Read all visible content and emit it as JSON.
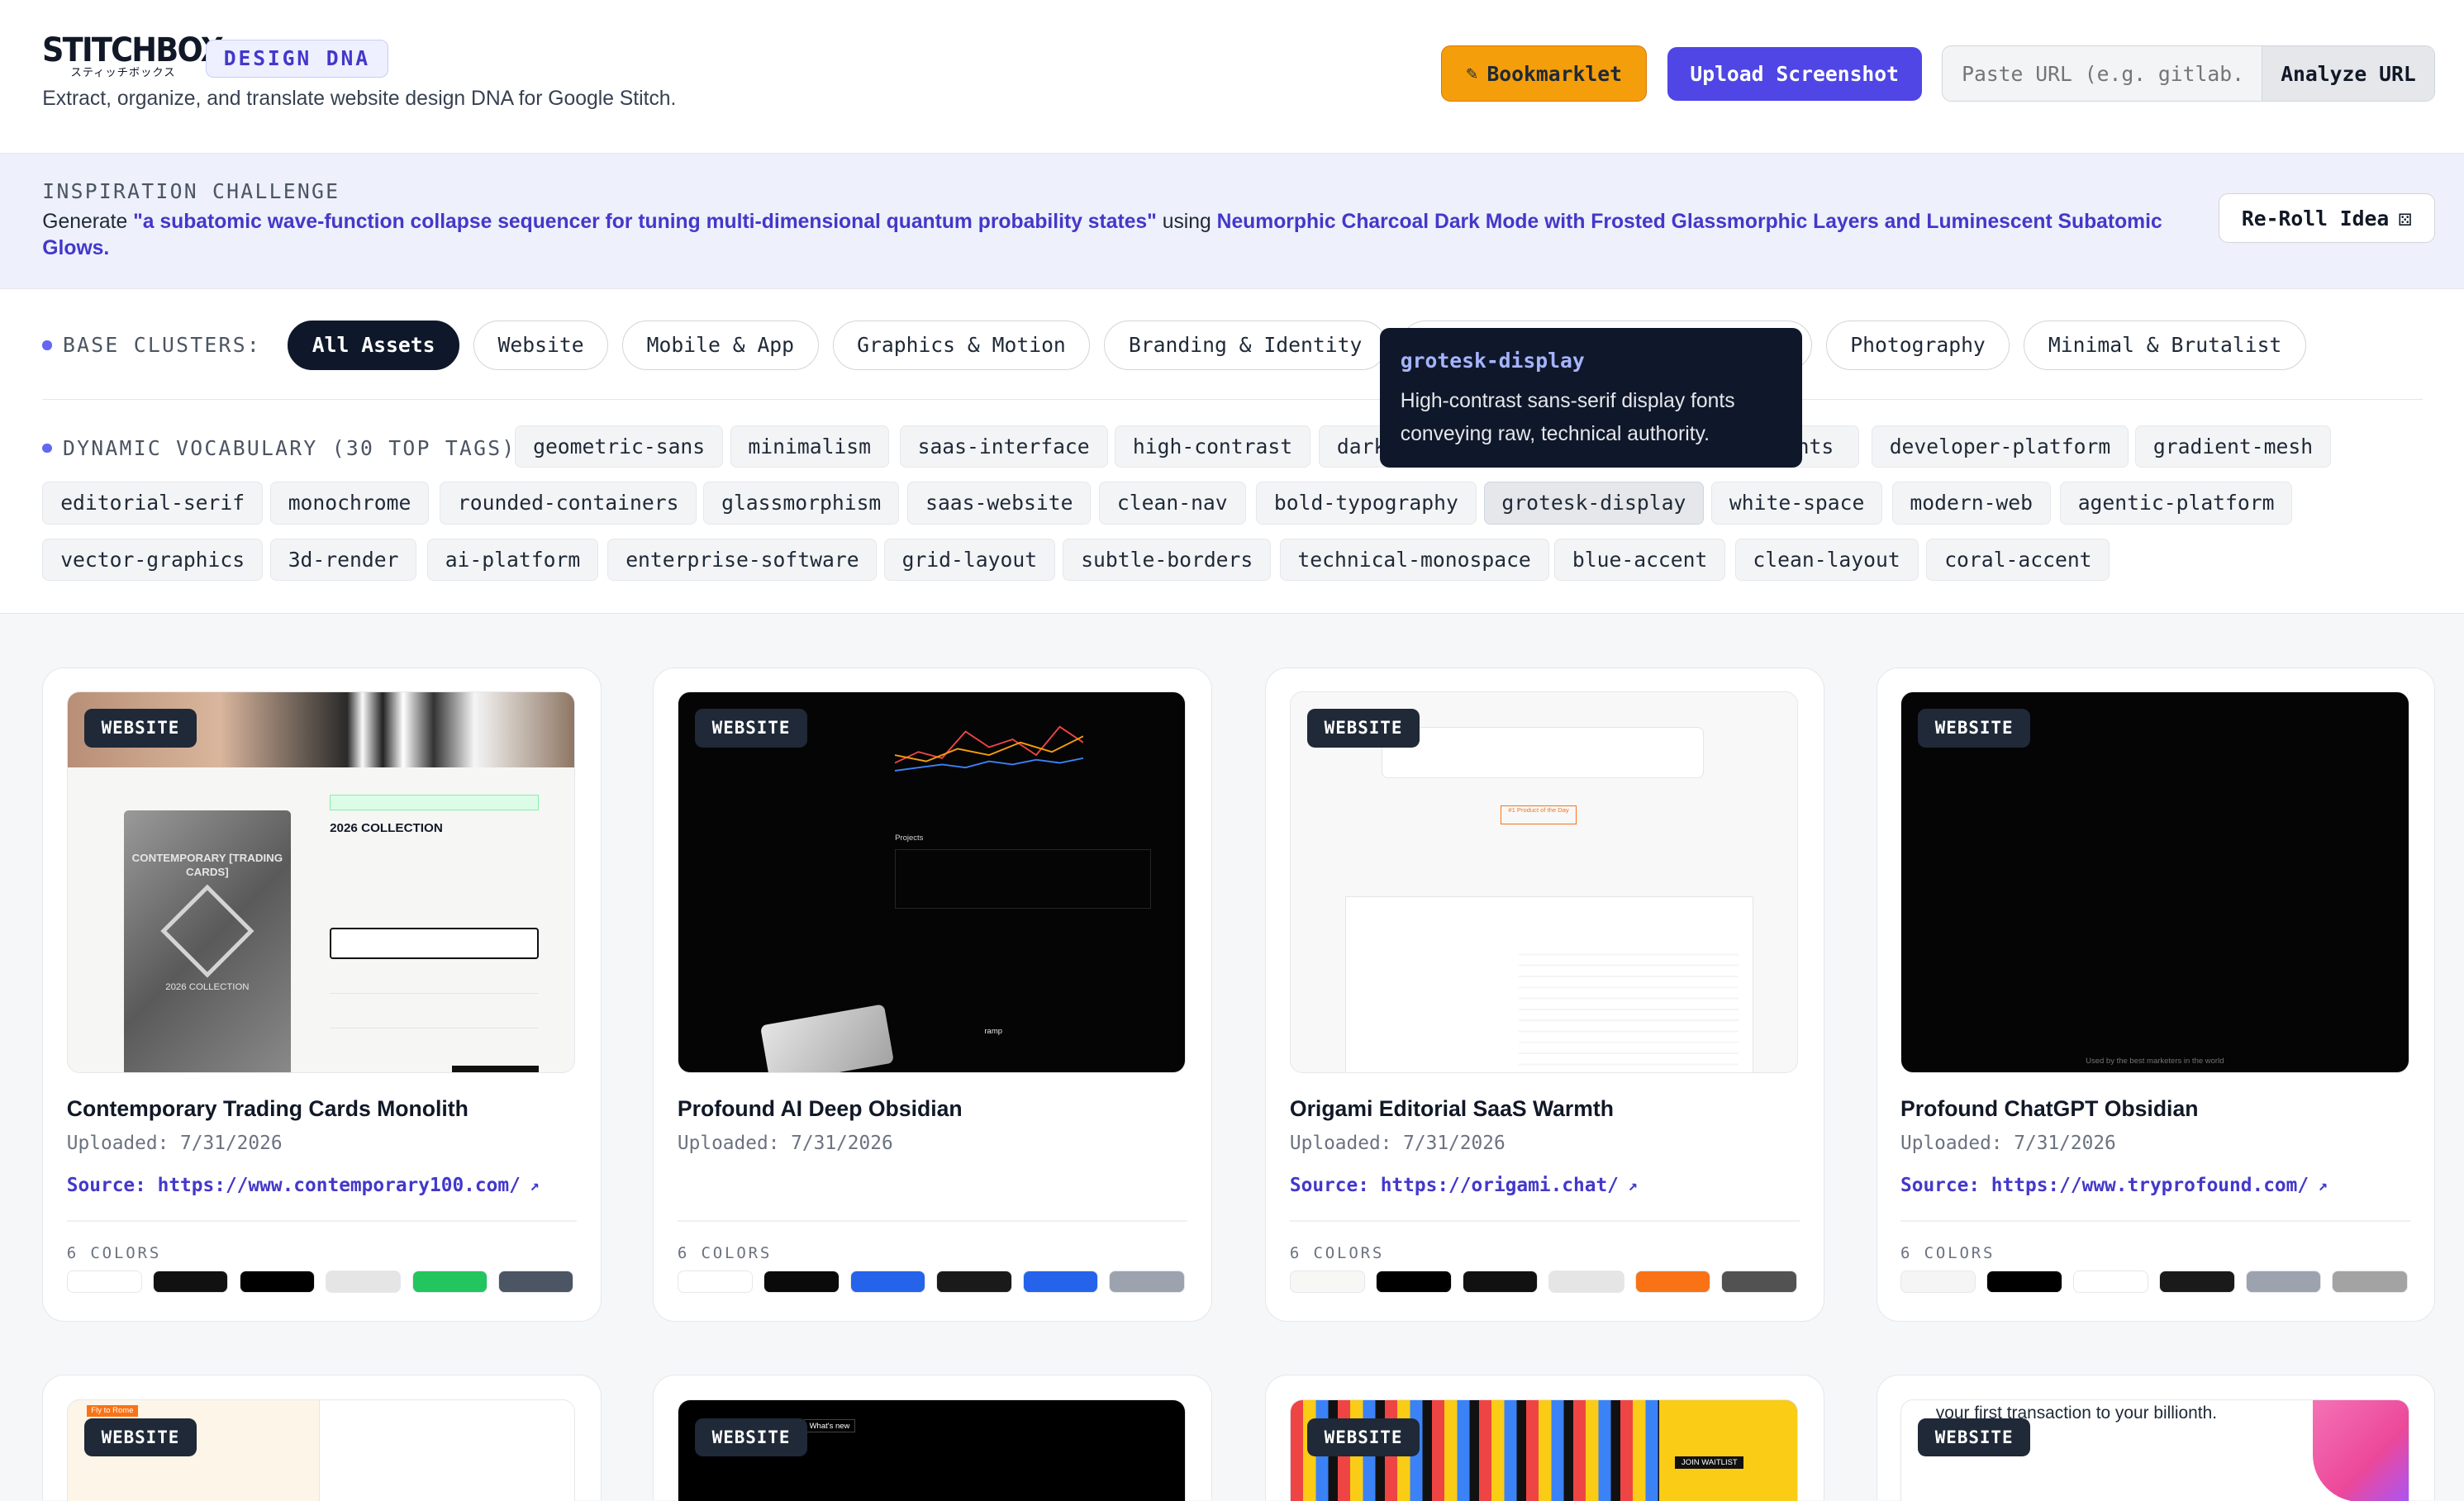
{
  "header": {
    "logo_text": "STITCHBOX",
    "logo_subtext": "スティッチボックス",
    "design_badge": "DESIGN DNA",
    "tagline": "Extract, organize, and translate website design DNA for Google Stitch.",
    "bookmarklet_label": "Bookmarklet",
    "upload_label": "Upload Screenshot",
    "url_placeholder": "Paste URL (e.g. gitlab.com)",
    "analyze_label": "Analyze URL"
  },
  "inspiration": {
    "label": "INSPIRATION CHALLENGE",
    "generate_word": "Generate",
    "idea": "\"a subatomic wave-function collapse sequencer for tuning multi-dimensional quantum probability states\"",
    "using_word": "using",
    "style": "Neumorphic Charcoal Dark Mode with Frosted Glassmorphic Layers and Luminescent Subatomic Glows",
    "period": ".",
    "reroll_label": "Re-Roll Idea",
    "reroll_icon": "dice-icon"
  },
  "clusters": {
    "label": "BASE CLUSTERS:",
    "items": [
      "All Assets",
      "Website",
      "Mobile & App",
      "Graphics & Motion",
      "Branding & Identity",
      "Photography",
      "Minimal & Brutalist"
    ],
    "active": "All Assets"
  },
  "vocab": {
    "label": "DYNAMIC VOCABULARY (30 TOP TAGS):",
    "tags": [
      "geometric-sans",
      "minimalism",
      "saas-interface",
      "high-contrast",
      "dark",
      "nts",
      "developer-platform",
      "gradient-mesh",
      "editorial-serif",
      "monochrome",
      "rounded-containers",
      "glassmorphism",
      "saas-website",
      "clean-nav",
      "bold-typography",
      "grotesk-display",
      "white-space",
      "modern-web",
      "agentic-platform",
      "vector-graphics",
      "3d-render",
      "ai-platform",
      "enterprise-software",
      "grid-layout",
      "subtle-borders",
      "technical-monospace",
      "blue-accent",
      "clean-layout",
      "coral-accent"
    ]
  },
  "tooltip": {
    "title": "grotesk-display",
    "body": "High-contrast sans-serif display fonts conveying raw, technical authority."
  },
  "cards": [
    {
      "badge": "WEBSITE",
      "title": "Contemporary Trading Cards Monolith",
      "date": "Uploaded: 7/31/2026",
      "source": "Source: https://www.contemporary100.com/",
      "colors_label": "6 COLORS",
      "colors": [
        "#ffffff",
        "#111111",
        "#000000",
        "#e5e5e5",
        "#22c55e",
        "#4b5563"
      ],
      "thumb_text": {
        "heading": "2026 COLLECTION",
        "pack": "CONTEMPORARY [TRADING CARDS]",
        "pack_year": "2026 COLLECTION"
      }
    },
    {
      "badge": "WEBSITE",
      "title": "Profound AI Deep Obsidian",
      "date": "Uploaded: 7/31/2026",
      "source": "",
      "colors_label": "6 COLORS",
      "colors": [
        "#ffffff",
        "#0a0a0a",
        "#2563eb",
        "#1a1a1a",
        "#2563eb",
        "#9ca3af"
      ],
      "thumb_text": {
        "heading": "Projects",
        "brand": "ramp"
      }
    },
    {
      "badge": "WEBSITE",
      "title": "Origami Editorial SaaS Warmth",
      "date": "Uploaded: 7/31/2026",
      "source": "Source: https://origami.chat/",
      "colors_label": "6 COLORS",
      "colors": [
        "#f7f7f5",
        "#000000",
        "#111111",
        "#e5e5e5",
        "#f97316",
        "#525252"
      ],
      "thumb_text": {
        "heading": "#1 Product of the Day"
      }
    },
    {
      "badge": "WEBSITE",
      "title": "Profound ChatGPT Obsidian",
      "date": "Uploaded: 7/31/2026",
      "source": "Source: https://www.tryprofound.com/",
      "colors_label": "6 COLORS",
      "colors": [
        "#f5f5f5",
        "#000000",
        "#ffffff",
        "#1a1a1a",
        "#9ca3af",
        "#a3a3a3"
      ],
      "thumb_text": {
        "caption": "Used by the best marketers in the world"
      }
    }
  ],
  "row2": [
    {
      "badge": "WEBSITE",
      "snippet": "Fly to Rome"
    },
    {
      "badge": "WEBSITE",
      "snippet": "What's new"
    },
    {
      "badge": "WEBSITE",
      "snippet": "JOIN WAITLIST"
    },
    {
      "badge": "WEBSITE",
      "snippet": "your first transaction to your billionth."
    }
  ],
  "accent_colors": {
    "primary": "#4f46e5",
    "bookmarklet": "#f59e0b",
    "dark": "#0f172a"
  }
}
